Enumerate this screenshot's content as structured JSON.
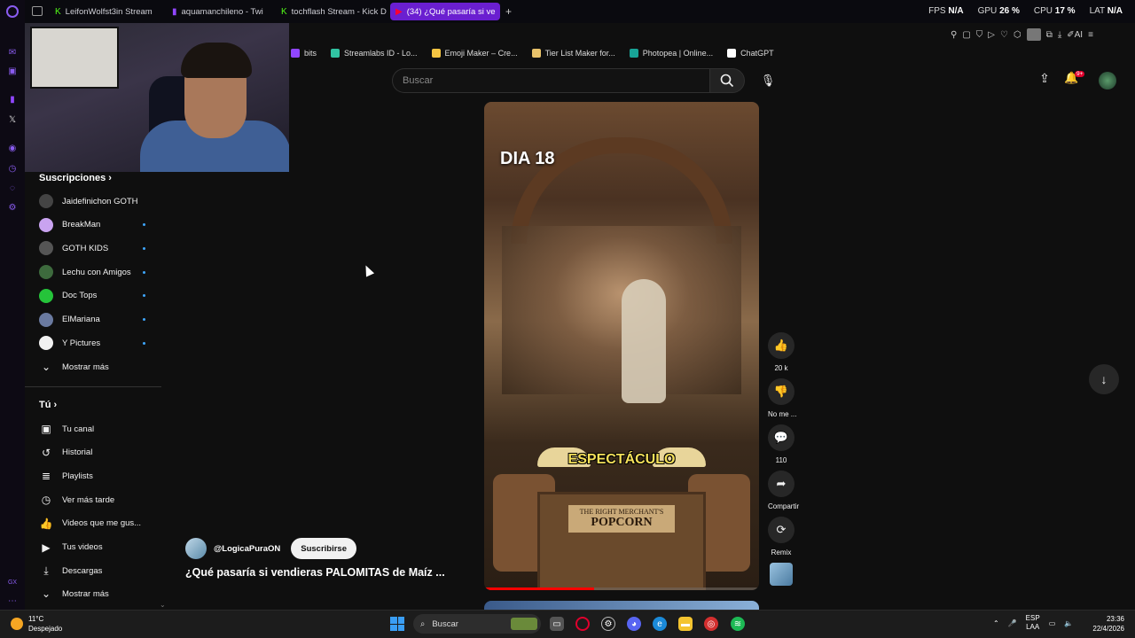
{
  "browser": {
    "tabs": [
      {
        "label": "LeifonWolfst3in Stream",
        "icon": "kick-icon",
        "color": "#53fc18"
      },
      {
        "label": "aquamanchileno - Twi",
        "icon": "twitch-icon",
        "color": "#9146ff"
      },
      {
        "label": "tochflash Stream - Kick D",
        "icon": "kick-icon",
        "color": "#53fc18"
      },
      {
        "label": "(34) ¿Qué pasaría si ve",
        "icon": "youtube-icon",
        "color": "#ff0033",
        "active": true
      }
    ],
    "new_tab": "+",
    "stats": [
      {
        "name": "FPS",
        "value": "N/A"
      },
      {
        "name": "GPU",
        "value": "26 %"
      },
      {
        "name": "CPU",
        "value": "17 %"
      },
      {
        "name": "LAT",
        "value": "N/A"
      }
    ],
    "bookmarks": [
      {
        "label": "bits",
        "icon": "bits-icon",
        "color": "#9146ff"
      },
      {
        "label": "Streamlabs ID - Lo...",
        "icon": "streamlabs-icon",
        "color": "#31c3a2"
      },
      {
        "label": "Emoji Maker – Cre...",
        "icon": "emoji-icon",
        "color": "#f5c542"
      },
      {
        "label": "Tier List Maker for...",
        "icon": "tierlist-icon",
        "color": "#e8c26a"
      },
      {
        "label": "Photopea | Online...",
        "icon": "photopea-icon",
        "color": "#18a497"
      },
      {
        "label": "ChatGPT",
        "icon": "chatgpt-icon",
        "color": "#ffffff"
      }
    ]
  },
  "youtube": {
    "search_placeholder": "Buscar",
    "notifications_badge": "9+",
    "sidebar": {
      "subs_title": "Suscripciones",
      "subs": [
        {
          "name": "Jaidefinichon GOTH",
          "dot": false,
          "color": "#444"
        },
        {
          "name": "BreakMan",
          "dot": true,
          "color": "#c9a3f0"
        },
        {
          "name": "GOTH KIDS",
          "dot": true,
          "color": "#555"
        },
        {
          "name": "Lechu con Amigos",
          "dot": true,
          "color": "#3d6a3d"
        },
        {
          "name": "Doc Tops",
          "dot": true,
          "color": "#25c43a"
        },
        {
          "name": "ElMariana",
          "dot": true,
          "color": "#6a7aa0"
        },
        {
          "name": "Y Pictures",
          "dot": true,
          "color": "#f1f1f1"
        }
      ],
      "subs_more": "Mostrar más",
      "you_title": "Tú",
      "you_items": [
        {
          "label": "Tu canal",
          "icon": "channel-icon"
        },
        {
          "label": "Historial",
          "icon": "history-icon"
        },
        {
          "label": "Playlists",
          "icon": "playlist-icon"
        },
        {
          "label": "Ver más tarde",
          "icon": "clock-icon"
        },
        {
          "label": "Videos que me gus...",
          "icon": "thumb-up-icon"
        },
        {
          "label": "Tus videos",
          "icon": "video-icon"
        },
        {
          "label": "Descargas",
          "icon": "download-icon"
        }
      ],
      "you_more": "Mostrar más"
    },
    "short": {
      "day_text": "DIA 18",
      "caption": "ESPECTÁCULO",
      "sign_top": "THE RIGHT MERCHANT'S",
      "sign_main": "POPCORN",
      "progress": 0.4,
      "channel": "@LogicaPuraON",
      "subscribe": "Suscribirse",
      "title": "¿Qué pasaría si vendieras PALOMITAS de Maíz ..."
    },
    "actions": [
      {
        "label": "20 k",
        "icon": "like-icon",
        "glyph": "👍"
      },
      {
        "label": "No me ...",
        "icon": "dislike-icon",
        "glyph": "👎"
      },
      {
        "label": "110",
        "icon": "comment-icon",
        "glyph": "💬"
      },
      {
        "label": "Compartir",
        "icon": "share-icon",
        "glyph": "➦"
      },
      {
        "label": "Remix",
        "icon": "remix-icon",
        "glyph": "⟳"
      }
    ]
  },
  "taskbar": {
    "weather_temp": "11°C",
    "weather_desc": "Despejado",
    "search": "Buscar",
    "lang_top": "ESP",
    "lang_bottom": "LAA",
    "time": "23:36",
    "date": "22/4/2026"
  }
}
